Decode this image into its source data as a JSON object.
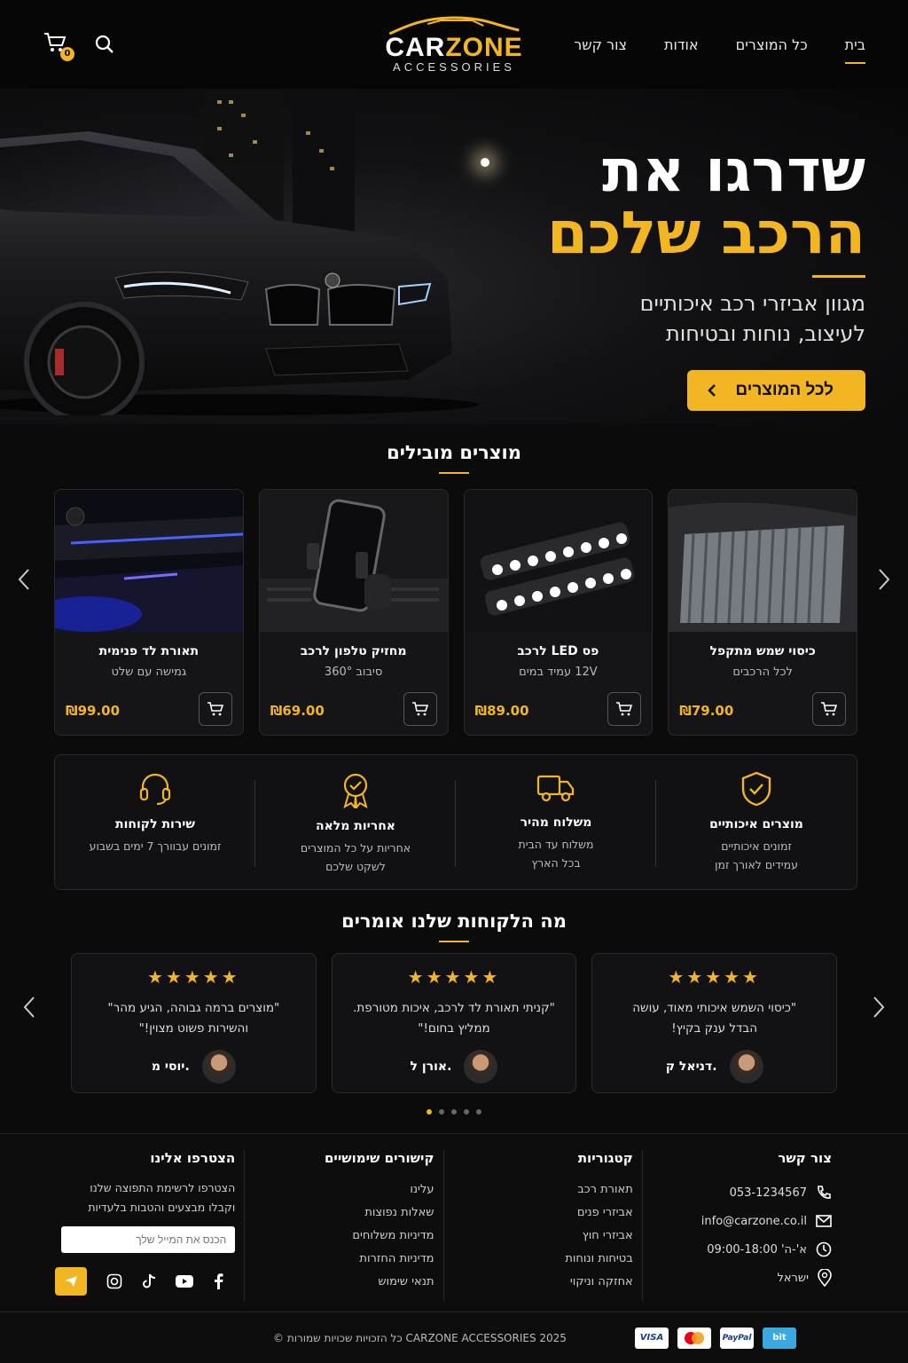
{
  "nav": {
    "items": [
      "בית",
      "כל המוצרים",
      "אודות",
      "צור קשר"
    ],
    "active_index": 0
  },
  "logo": {
    "brand_white": "CAR",
    "brand_yellow": "ZONE",
    "sub": "ACCESSORIES"
  },
  "cart": {
    "count": "0"
  },
  "hero": {
    "title_line1": "שדרגו את",
    "title_line2": "הרכב שלכם",
    "subtitle_line1": "מגוון אביזרי רכב איכותיים",
    "subtitle_line2": "לעיצוב, נוחות ובטיחות",
    "cta": "לכל המוצרים"
  },
  "featured": {
    "title": "מוצרים מובילים",
    "products": [
      {
        "name": "כיסוי שמש מתקפל",
        "sub": "לכל הרכבים",
        "price": "₪79.00",
        "image": "sunshade"
      },
      {
        "name": "פס LED לרכב",
        "sub": "12V עמיד במים",
        "price": "₪89.00",
        "image": "led-bar"
      },
      {
        "name": "מחזיק טלפון לרכב",
        "sub": "סיבוב 360°",
        "price": "₪69.00",
        "image": "phone-holder"
      },
      {
        "name": "תאורת לד פנימית",
        "sub": "גמישה עם שלט",
        "price": "₪99.00",
        "image": "ambient-light"
      }
    ]
  },
  "features": [
    {
      "title": "מוצרים איכותיים",
      "line1": "זמונים איכותיים",
      "line2": "עמידים לאורך זמן",
      "icon": "shield-check-icon"
    },
    {
      "title": "משלוח מהיר",
      "line1": "משלוח עד הבית",
      "line2": "בכל הארץ",
      "icon": "truck-icon"
    },
    {
      "title": "אחריות מלאה",
      "line1": "אחריות על כל המוצרים",
      "line2": "לשקט שלכם",
      "icon": "award-badge-icon"
    },
    {
      "title": "שירות לקוחות",
      "line1": "זמונים עבוורך 7 ימים בשבוע",
      "line2": "",
      "icon": "headset-icon"
    }
  ],
  "testimonials": {
    "title": "מה הלקוחות שלנו אומרים",
    "items": [
      {
        "stars": "★★★★★",
        "quote1": "\"כיסוי השמש איכותי מאוד, עושה",
        "quote2": "הבדל ענק בקיץ!",
        "author": "דניאל ק."
      },
      {
        "stars": "★★★★★",
        "quote1": "\"קניתי תאורת לד לרכב, איכות מטורפת.",
        "quote2": "ממליץ בחום!\"",
        "author": "אורן ל."
      },
      {
        "stars": "★★★★★",
        "quote1": "\"מוצרים ברמה גבוהה, הגיע מהר\"",
        "quote2": "והשירות פשוט מצוין!\"",
        "author": "יוסי מ."
      }
    ],
    "active_dot": 0,
    "dot_count": 5
  },
  "footer": {
    "contact": {
      "title": "צור קשר",
      "phone": "053-1234567",
      "email": "info@carzone.co.il",
      "hours": "א'-ה' 09:00-18:00",
      "location": "ישראל"
    },
    "categories": {
      "title": "קטגוריות",
      "links": [
        "תאורת רכב",
        "אביזרי פנים",
        "אביזרי חוץ",
        "בטיחות ונוחות",
        "אחזקה וניקוי"
      ]
    },
    "useful": {
      "title": "קישורים שימושיים",
      "links": [
        "עלינו",
        "שאלות נפוצות",
        "מדיניות משלוחים",
        "מדיניות החזרות",
        "תנאי שימוש"
      ]
    },
    "newsletter": {
      "title": "הצטרפו אלינו",
      "line1": "הצטרפו לרשימת התפוצה שלנו",
      "line2": "וקבלו מבצעים והטבות בלעדיות",
      "placeholder": "הכנס את המייל שלך"
    },
    "copyright": "© כל הזכויות שכויות שמורות CARZONE ACCESSORIES 2025",
    "payments": [
      "VISA",
      "Mastercard",
      "PayPal",
      "bit"
    ]
  },
  "colors": {
    "accent": "#f2b623",
    "background": "#0b0b0c"
  }
}
